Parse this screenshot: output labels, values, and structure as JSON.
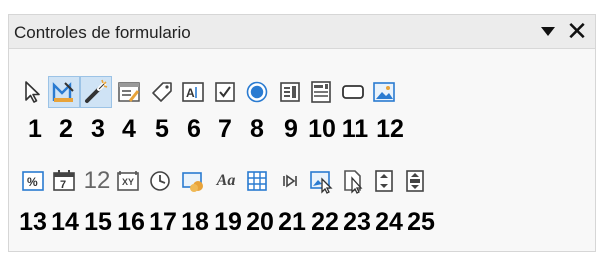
{
  "panel": {
    "title": "Controles de formulario",
    "menu_icon": "chevron-down-icon",
    "close_icon": "close-icon",
    "close_glyph": "✕"
  },
  "row1": {
    "tools": [
      {
        "icon": "select-pointer-icon",
        "active": false
      },
      {
        "icon": "design-mode-icon",
        "active": true
      },
      {
        "icon": "control-wizards-icon",
        "active": true
      },
      {
        "icon": "form-design-icon",
        "active": false
      },
      {
        "icon": "label-tag-icon",
        "active": false
      },
      {
        "icon": "text-box-icon",
        "active": false
      },
      {
        "icon": "check-box-icon",
        "active": false
      },
      {
        "icon": "option-button-icon",
        "active": false
      },
      {
        "icon": "list-box-icon",
        "active": false
      },
      {
        "icon": "combo-box-icon",
        "active": false
      },
      {
        "icon": "push-button-icon",
        "active": false
      },
      {
        "icon": "image-button-icon",
        "active": false
      }
    ],
    "numbers": [
      "1",
      "2",
      "3",
      "4",
      "5",
      "6",
      "7",
      "8",
      "9",
      "10",
      "11",
      "12"
    ]
  },
  "row2": {
    "tools": [
      {
        "icon": "formatted-field-icon"
      },
      {
        "icon": "date-field-icon"
      },
      {
        "icon": "numerical-field-icon",
        "glyph": "12"
      },
      {
        "icon": "pattern-field-icon"
      },
      {
        "icon": "time-field-icon"
      },
      {
        "icon": "currency-field-icon"
      },
      {
        "icon": "label-field-icon",
        "glyph": "Aa"
      },
      {
        "icon": "table-control-icon"
      },
      {
        "icon": "navigation-bar-icon"
      },
      {
        "icon": "image-control-icon"
      },
      {
        "icon": "file-selection-icon"
      },
      {
        "icon": "spin-button-icon"
      },
      {
        "icon": "scrollbar-icon"
      }
    ],
    "numbers": [
      "13",
      "14",
      "15",
      "16",
      "17",
      "18",
      "19",
      "20",
      "21",
      "22",
      "23",
      "24",
      "25"
    ]
  },
  "colors": {
    "accent": "#2a7bd1",
    "active_bg": "#cfe3f5",
    "brand_orange": "#e8a33a"
  }
}
